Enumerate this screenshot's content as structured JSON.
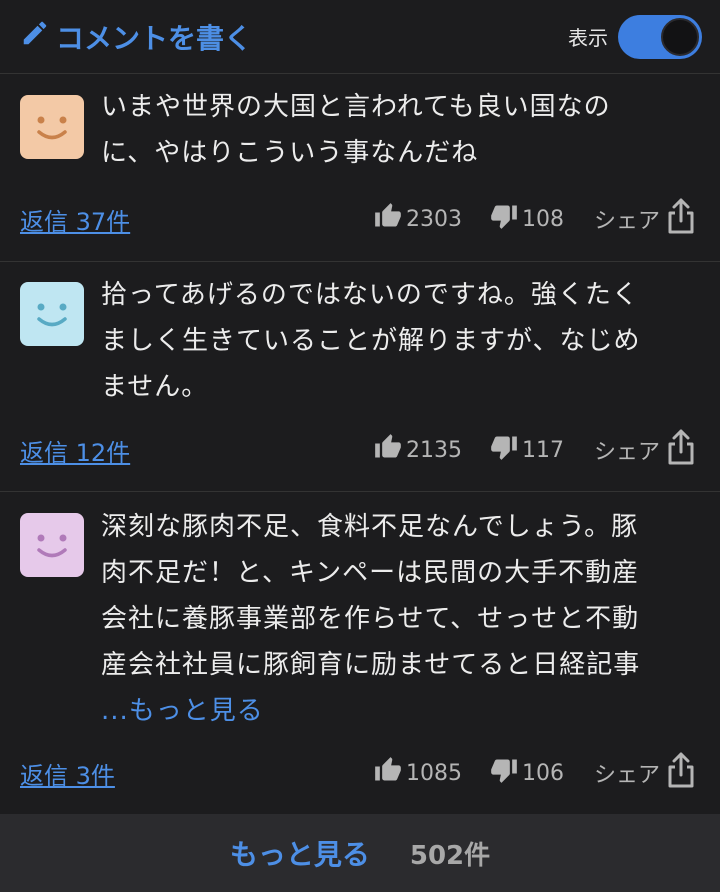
{
  "header": {
    "write_label": "コメントを書く",
    "toggle_label": "表示",
    "toggle_on": true
  },
  "comments": [
    {
      "avatar_color": "#f3c9a6",
      "face_color": "#c9814a",
      "text_lines": [
        "いまや世界の大国と言われても良い国なの",
        "に、やはりこういう事なんだね"
      ],
      "reply_label": "返信 37件",
      "likes": "2303",
      "dislikes": "108",
      "share_label": "シェア"
    },
    {
      "avatar_color": "#bfe6f2",
      "face_color": "#58aac4",
      "text_lines": [
        "拾ってあげるのではないのですね。強くたく",
        "ましく生きていることが解りますが、なじめ",
        "ません。"
      ],
      "reply_label": "返信 12件",
      "likes": "2135",
      "dislikes": "117",
      "share_label": "シェア"
    },
    {
      "avatar_color": "#e6c9ea",
      "face_color": "#b07ab9",
      "text_lines": [
        "深刻な豚肉不足、食料不足なんでしょう。豚",
        "肉不足だ！と、キンペーは民間の大手不動産",
        "会社に養豚事業部を作らせて、せっせと不動",
        "産会社社員に豚飼育に励ませてると日経記事"
      ],
      "more_label": "...もっと見る",
      "reply_label": "返信 3件",
      "likes": "1085",
      "dislikes": "106",
      "share_label": "シェア"
    }
  ],
  "footer": {
    "more_label": "もっと見る",
    "count_label": "502件"
  }
}
